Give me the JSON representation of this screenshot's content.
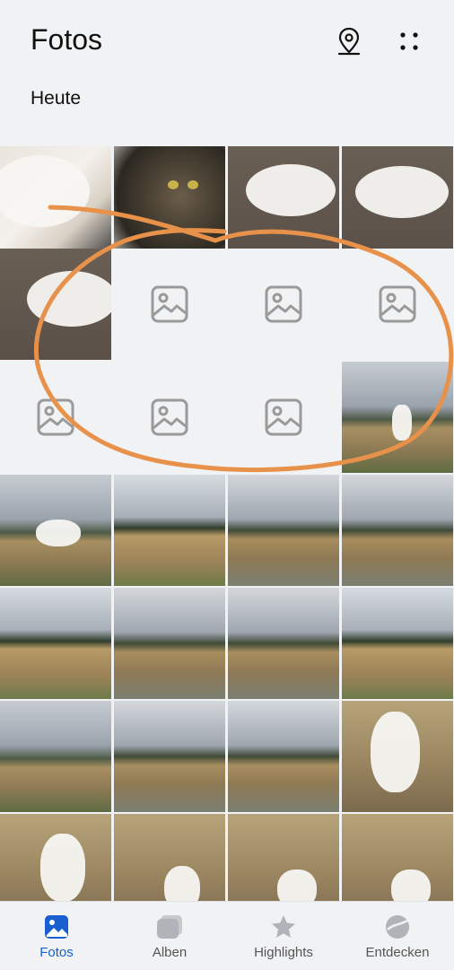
{
  "header": {
    "title": "Fotos",
    "icons": [
      "location-pin-icon",
      "more-dots-icon"
    ]
  },
  "section": {
    "label": "Heute"
  },
  "colors": {
    "accent": "#1a5fd0",
    "annotation": "#e8914a",
    "placeholder_icon": "#9a9a9a"
  },
  "tabs": [
    {
      "label": "Fotos",
      "icon": "photos-icon",
      "active": true
    },
    {
      "label": "Alben",
      "icon": "albums-icon",
      "active": false
    },
    {
      "label": "Highlights",
      "icon": "star-icon",
      "active": false
    },
    {
      "label": "Entdecken",
      "icon": "discover-icon",
      "active": false
    }
  ]
}
